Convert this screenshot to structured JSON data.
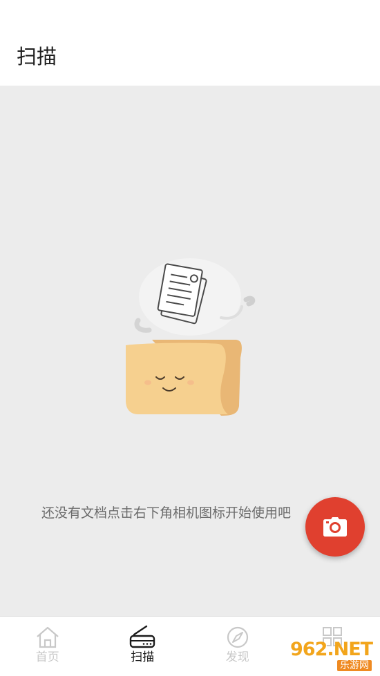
{
  "header": {
    "title": "扫描"
  },
  "empty_state": {
    "message": "还没有文档点击右下角相机图标开始使用吧",
    "illustration": "folder-with-document-icon"
  },
  "fab": {
    "icon": "camera-icon",
    "color": "#e0402f"
  },
  "bottom_nav": {
    "items": [
      {
        "label": "首页",
        "icon": "home-icon",
        "active": false
      },
      {
        "label": "扫描",
        "icon": "scanner-icon",
        "active": true
      },
      {
        "label": "发现",
        "icon": "compass-icon",
        "active": false
      },
      {
        "label": "",
        "icon": "grid-icon",
        "active": false
      }
    ]
  },
  "watermark": {
    "brand": "962.NET",
    "sub": "乐游网"
  }
}
